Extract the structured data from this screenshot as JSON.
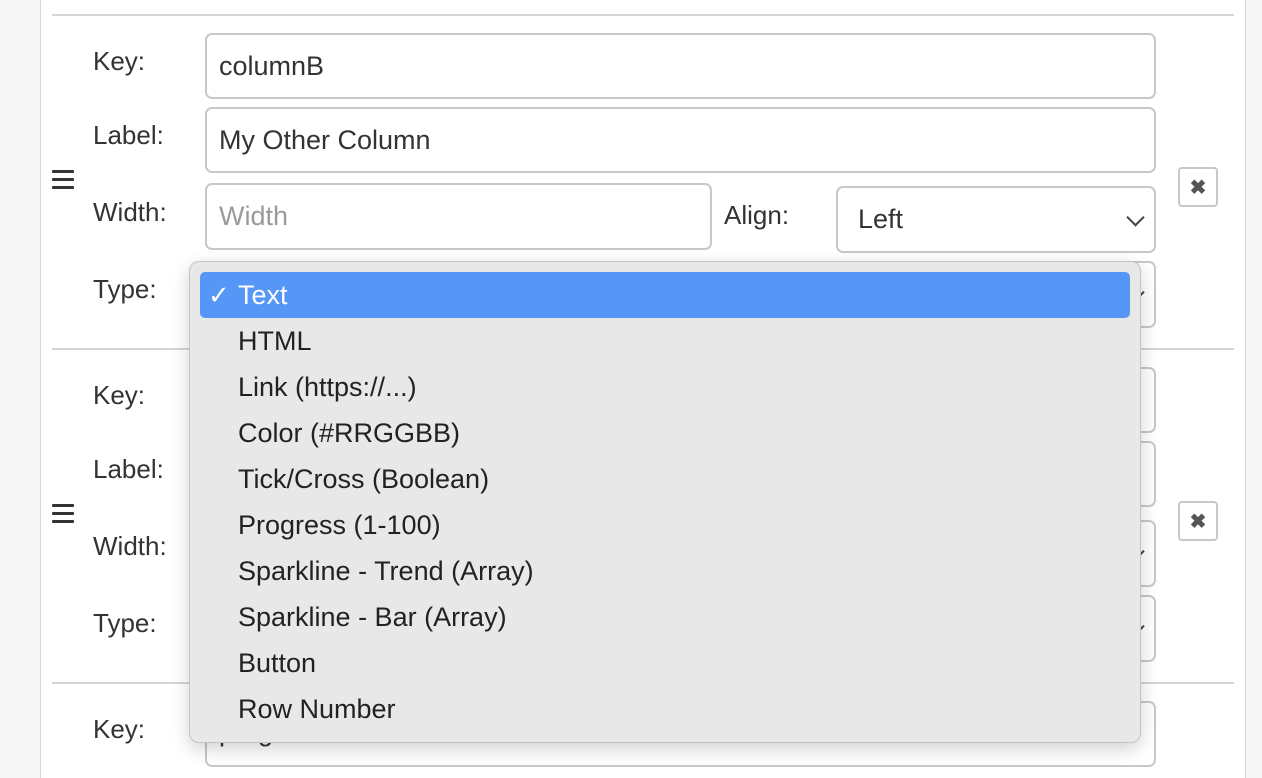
{
  "rows": [
    {
      "key_label": "Key:",
      "key_value": "columnB",
      "label_label": "Label:",
      "label_value": "My Other Column",
      "width_label": "Width:",
      "width_placeholder": "Width",
      "align_label": "Align:",
      "align_value": "Left",
      "type_label": "Type:"
    },
    {
      "key_label": "Key:",
      "label_label": "Label:",
      "width_label": "Width:",
      "type_label": "Type:"
    },
    {
      "key_label": "Key:",
      "key_value": "progress"
    }
  ],
  "remove_glyph": "✖",
  "type_dropdown": {
    "check_mark": "✓",
    "selected_index": 0,
    "options": [
      "Text",
      "HTML",
      "Link (https://...)",
      "Color (#RRGGBB)",
      "Tick/Cross (Boolean)",
      "Progress (1-100)",
      "Sparkline - Trend (Array)",
      "Sparkline - Bar (Array)",
      "Button",
      "Row Number"
    ]
  },
  "colors": {
    "selected_option_bg": "#5596f7",
    "dropdown_bg": "#e8e8e8"
  }
}
